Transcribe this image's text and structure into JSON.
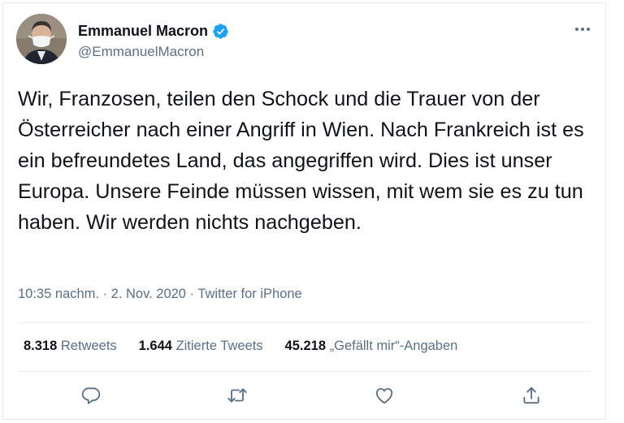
{
  "user": {
    "name": "Emmanuel Macron",
    "handle": "@EmmanuelMacron"
  },
  "tweet": {
    "text": "Wir, Franzosen, teilen den Schock und die Trauer von der Österreicher nach einer Angriff in Wien. Nach Frankreich ist es ein befreundetes Land, das angegriffen wird. Dies ist unser Europa. Unsere Feinde müssen wissen, mit wem sie es zu tun haben. Wir werden nichts nachgeben.",
    "meta": "10:35 nachm. · 2. Nov. 2020 · Twitter for iPhone"
  },
  "stats": {
    "retweets_count": "8.318",
    "retweets_label": "Retweets",
    "quotes_count": "1.644",
    "quotes_label": "Zitierte Tweets",
    "likes_count": "45.218",
    "likes_label": "„Gefällt mir“-Angaben"
  },
  "icons": {
    "more": "more-icon",
    "verified": "verified-badge-icon",
    "reply": "reply-icon",
    "retweet": "retweet-icon",
    "like": "like-icon",
    "share": "share-icon"
  },
  "colors": {
    "text": "#0f1419",
    "secondary": "#5b7083",
    "verified": "#1da1f2",
    "border": "#e6ecf0"
  }
}
